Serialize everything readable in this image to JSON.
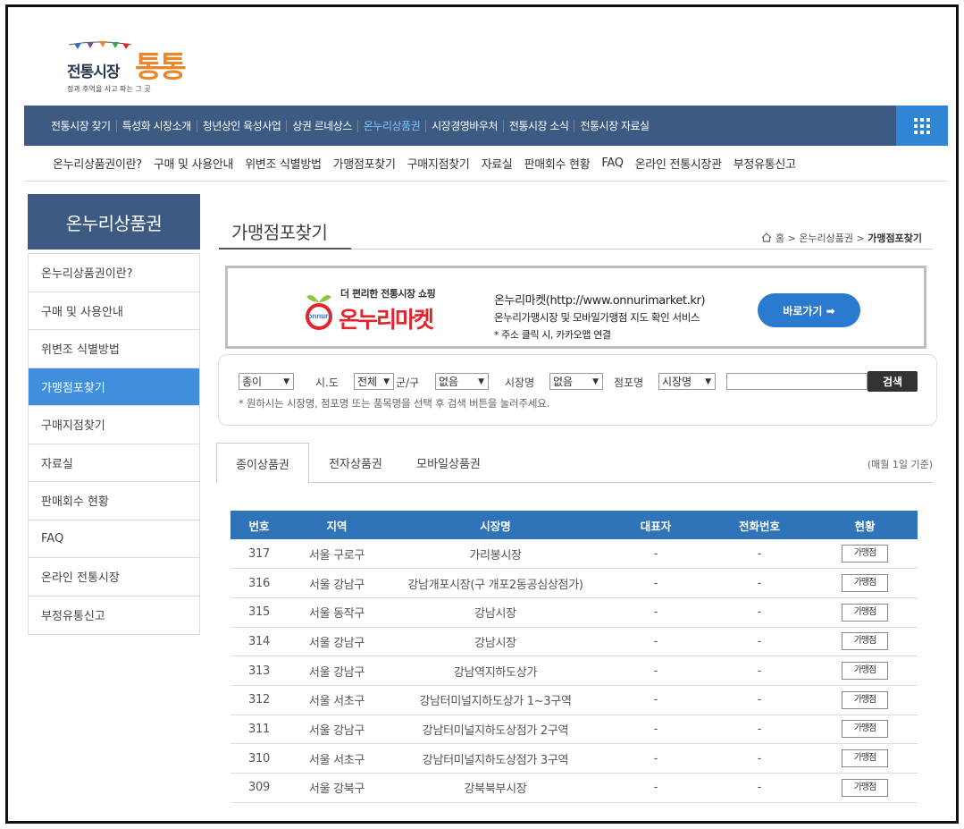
{
  "logo": {
    "main": "전통시장",
    "big": "통통",
    "sub": "정과 추억을 사고 파는 그 곳"
  },
  "nav": {
    "items": [
      "전통시장 찾기",
      "특성화 시장소개",
      "청년상인 육성사업",
      "상권 르네상스",
      "온누리상품권",
      "시장경영바우처",
      "전통시장 소식",
      "전통시장 자료실"
    ],
    "active_index": 4
  },
  "subnav": [
    "온누리상품권이란?",
    "구매 및 사용안내",
    "위변조 식별방법",
    "가맹점포찾기",
    "구매지점찾기",
    "자료실",
    "판매회수 현황",
    "FAQ",
    "온라인 전통시장관",
    "부정유통신고"
  ],
  "sidebar": {
    "title": "온누리상품권",
    "items": [
      "온누리상품권이란?",
      "구매 및 사용안내",
      "위변조 식별방법",
      "가맹점포찾기",
      "구매지점찾기",
      "자료실",
      "판매회수 현황",
      "FAQ",
      "온라인 전통시장",
      "부정유통신고"
    ],
    "active_index": 3
  },
  "page": {
    "title": "가맹점포찾기",
    "breadcrumb": {
      "home": "홈",
      "sep": ">",
      "parent": "온누리상품권",
      "current": "가맹점포찾기"
    }
  },
  "banner": {
    "logo_text": "onnuri",
    "small": "더 편리한 전통시장 쇼핑",
    "big": "온누리마켓",
    "line1": "온누리마켓(http://www.onnurimarket.kr)",
    "line2": "온누리가맹시장 및 모바일가맹점 지도 확인 서비스",
    "line3": "* 주소 클릭 시, 카카오맵 연결",
    "button": "바로가기 ➡"
  },
  "search": {
    "type_value": "종이",
    "sido_label": "시.도",
    "sido_value": "전체",
    "gugun_label": "군/구",
    "gugun_value": "없음",
    "market_label": "시장명",
    "market_value": "없음",
    "store_label": "점포명",
    "store_value": "시장명",
    "keyword": "",
    "button": "검색",
    "hint": "* 원하시는 시장명, 점포명 또는 품목명을 선택 후 검색 버튼을 눌러주세요."
  },
  "tabs": {
    "items": [
      "종이상품권",
      "전자상품권",
      "모바일상품권"
    ],
    "active_index": 0,
    "basis": "(매월 1일 기준)"
  },
  "table": {
    "headers": [
      "번호",
      "지역",
      "시장명",
      "대표자",
      "전화번호",
      "현황"
    ],
    "rows": [
      [
        "317",
        "서울 구로구",
        "가리봉시장",
        "-",
        "-",
        "가맹점"
      ],
      [
        "316",
        "서울 강남구",
        "강남개포시장(구 개포2동공심상점가)",
        "-",
        "-",
        "가맹점"
      ],
      [
        "315",
        "서울 동작구",
        "강남시장",
        "-",
        "-",
        "가맹점"
      ],
      [
        "314",
        "서울 강남구",
        "강남시장",
        "-",
        "-",
        "가맹점"
      ],
      [
        "313",
        "서울 강남구",
        "강남역지하도상가",
        "-",
        "-",
        "가맹점"
      ],
      [
        "312",
        "서울 서초구",
        "강남터미널지하도상가 1~3구역",
        "-",
        "-",
        "가맹점"
      ],
      [
        "311",
        "서울 강남구",
        "강남터미널지하도상점가 2구역",
        "-",
        "-",
        "가맹점"
      ],
      [
        "310",
        "서울 서초구",
        "강남터미널지하도상점가 3구역",
        "-",
        "-",
        "가맹점"
      ],
      [
        "309",
        "서울 강북구",
        "강북북부시장",
        "-",
        "-",
        "가맹점"
      ]
    ]
  },
  "colors": {
    "nav_bg": "#3c5a82",
    "accent_blue": "#3f8fdd",
    "table_head": "#2f74b9",
    "banner_red": "#e4232d"
  }
}
